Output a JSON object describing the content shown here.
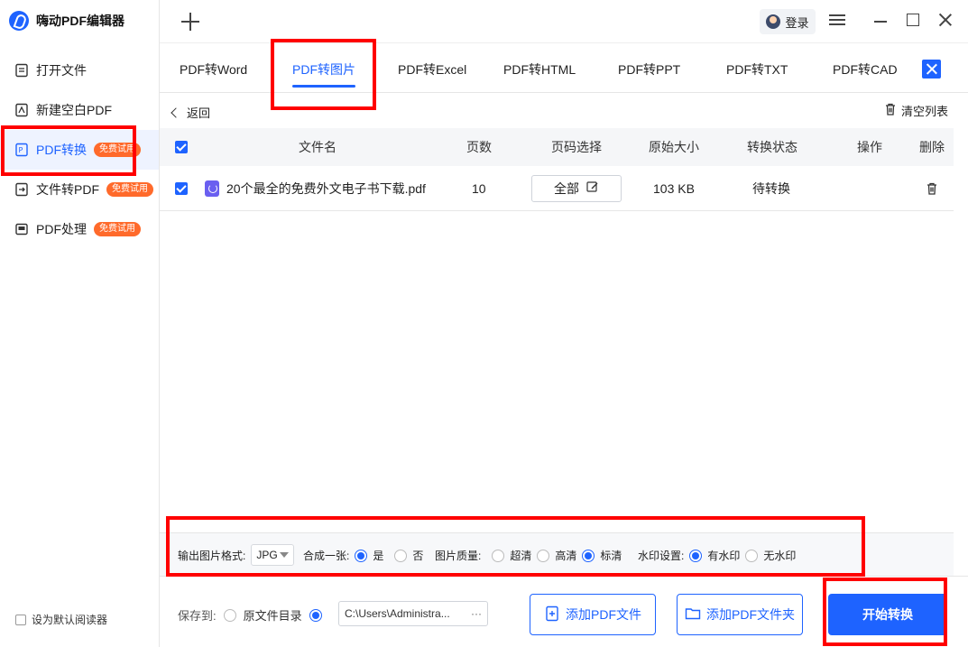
{
  "app": {
    "title": "嗨动PDF编辑器"
  },
  "sidebar": {
    "items": [
      {
        "label": "打开文件",
        "icon": "open-file-icon"
      },
      {
        "label": "新建空白PDF",
        "icon": "new-pdf-icon"
      },
      {
        "label": "PDF转换",
        "icon": "pdf-convert-icon",
        "badge": "免费试用",
        "active": true
      },
      {
        "label": "文件转PDF",
        "icon": "file-to-pdf-icon",
        "badge": "免费试用"
      },
      {
        "label": "PDF处理",
        "icon": "pdf-process-icon",
        "badge": "免费试用"
      }
    ],
    "default_reader": "设为默认阅读器"
  },
  "topbar": {
    "login": "登录"
  },
  "tabs": [
    {
      "label": "PDF转Word"
    },
    {
      "label": "PDF转图片",
      "active": true
    },
    {
      "label": "PDF转Excel"
    },
    {
      "label": "PDF转HTML"
    },
    {
      "label": "PDF转PPT"
    },
    {
      "label": "PDF转TXT"
    },
    {
      "label": "PDF转CAD"
    }
  ],
  "list": {
    "back": "返回",
    "clear": "清空列表",
    "headers": {
      "name": "文件名",
      "pages": "页数",
      "page_select": "页码选择",
      "size": "原始大小",
      "status": "转换状态",
      "actions": "操作",
      "delete": "删除"
    },
    "rows": [
      {
        "name": "20个最全的免费外文电子书下载.pdf",
        "pages": "10",
        "page_select": "全部",
        "size": "103 KB",
        "status": "待转换"
      }
    ]
  },
  "options": {
    "format_label": "输出图片格式:",
    "format_value": "JPG",
    "merge_label": "合成一张:",
    "merge_yes": "是",
    "merge_no": "否",
    "quality_label": "图片质量:",
    "quality_ultra": "超清",
    "quality_high": "高清",
    "quality_standard": "标清",
    "watermark_label": "水印设置:",
    "watermark_yes": "有水印",
    "watermark_no": "无水印"
  },
  "bottom": {
    "save_to": "保存到:",
    "original_dir": "原文件目录",
    "path": "C:\\Users\\Administra...",
    "more": "···",
    "add_file": "添加PDF文件",
    "add_folder": "添加PDF文件夹",
    "start": "开始转换"
  },
  "colors": {
    "accent": "#1e63ff",
    "badge": "#ff6a2b",
    "highlight": "#ff0000"
  }
}
